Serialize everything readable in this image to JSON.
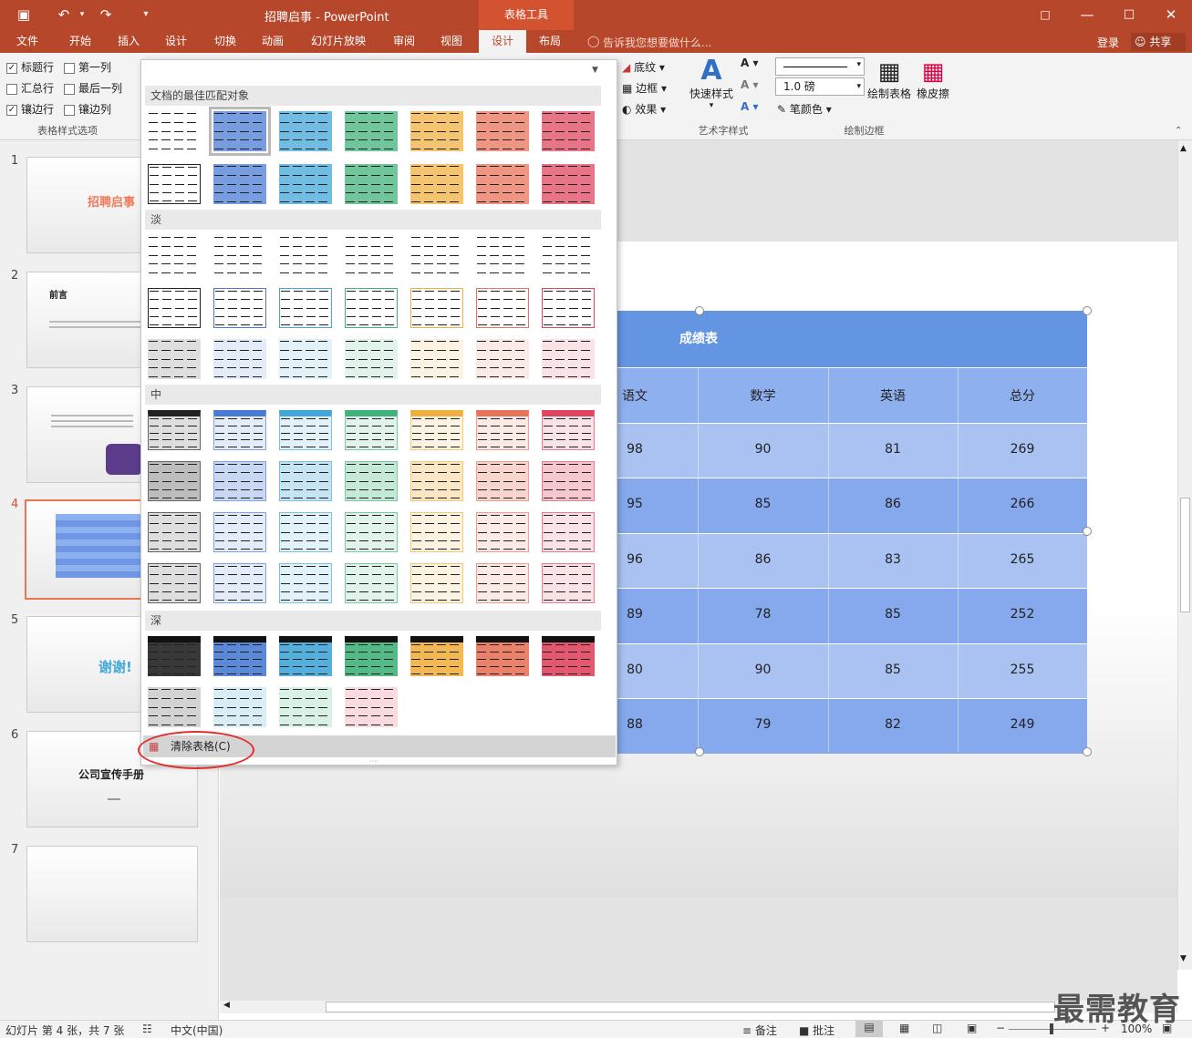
{
  "window": {
    "title": "招聘启事 - PowerPoint",
    "context_group": "表格工具",
    "login": "登录",
    "share": "共享"
  },
  "tabs": [
    "文件",
    "开始",
    "插入",
    "设计",
    "切换",
    "动画",
    "幻灯片放映",
    "审阅",
    "视图",
    "设计",
    "布局"
  ],
  "tell_me": "告诉我您想要做什么...",
  "ribbon": {
    "options": [
      {
        "label": "标题行",
        "checked": true
      },
      {
        "label": "第一列",
        "checked": false
      },
      {
        "label": "汇总行",
        "checked": false
      },
      {
        "label": "最后一列",
        "checked": false
      },
      {
        "label": "镶边行",
        "checked": true
      },
      {
        "label": "镶边列",
        "checked": false
      }
    ],
    "options_group": "表格样式选项",
    "shading": "底纹",
    "border": "边框",
    "effect": "效果",
    "quick_styles": "快速样式",
    "wordart_group": "艺术字样式",
    "pen_weight": "1.0 磅",
    "pen_color": "笔颜色",
    "draw_table": "绘制表格",
    "eraser": "橡皮擦",
    "draw_group": "绘制边框"
  },
  "thumbnails": [
    {
      "num": "1",
      "text": "招聘启事"
    },
    {
      "num": "2",
      "text": "前言"
    },
    {
      "num": "3",
      "text": ""
    },
    {
      "num": "4",
      "text": ""
    },
    {
      "num": "5",
      "text": "谢谢!"
    },
    {
      "num": "6",
      "text": "公司宣传手册"
    },
    {
      "num": "7",
      "text": ""
    }
  ],
  "gallery": {
    "sections": [
      "文档的最佳匹配对象",
      "淡",
      "中",
      "深"
    ],
    "clear": "清除表格(C)"
  },
  "colors": {
    "accent": "#b7472a",
    "styles": [
      "#222222",
      "#4a7bd4",
      "#41a6d8",
      "#40b27a",
      "#f0b040",
      "#e8735a",
      "#e0455f"
    ]
  },
  "table": {
    "title": "成绩表",
    "header": [
      "语文",
      "数学",
      "英语",
      "总分"
    ],
    "rows": [
      [
        "98",
        "90",
        "81",
        "269"
      ],
      [
        "95",
        "85",
        "86",
        "266"
      ],
      [
        "96",
        "86",
        "83",
        "265"
      ],
      [
        "89",
        "78",
        "85",
        "252"
      ],
      [
        "80",
        "90",
        "85",
        "255"
      ],
      [
        "88",
        "79",
        "82",
        "249"
      ]
    ]
  },
  "status": {
    "slide_info": "幻灯片 第 4 张，共 7 张",
    "language": "中文(中国)",
    "notes": "备注",
    "comments": "批注",
    "zoom": "100%"
  },
  "watermark": "最需教育"
}
